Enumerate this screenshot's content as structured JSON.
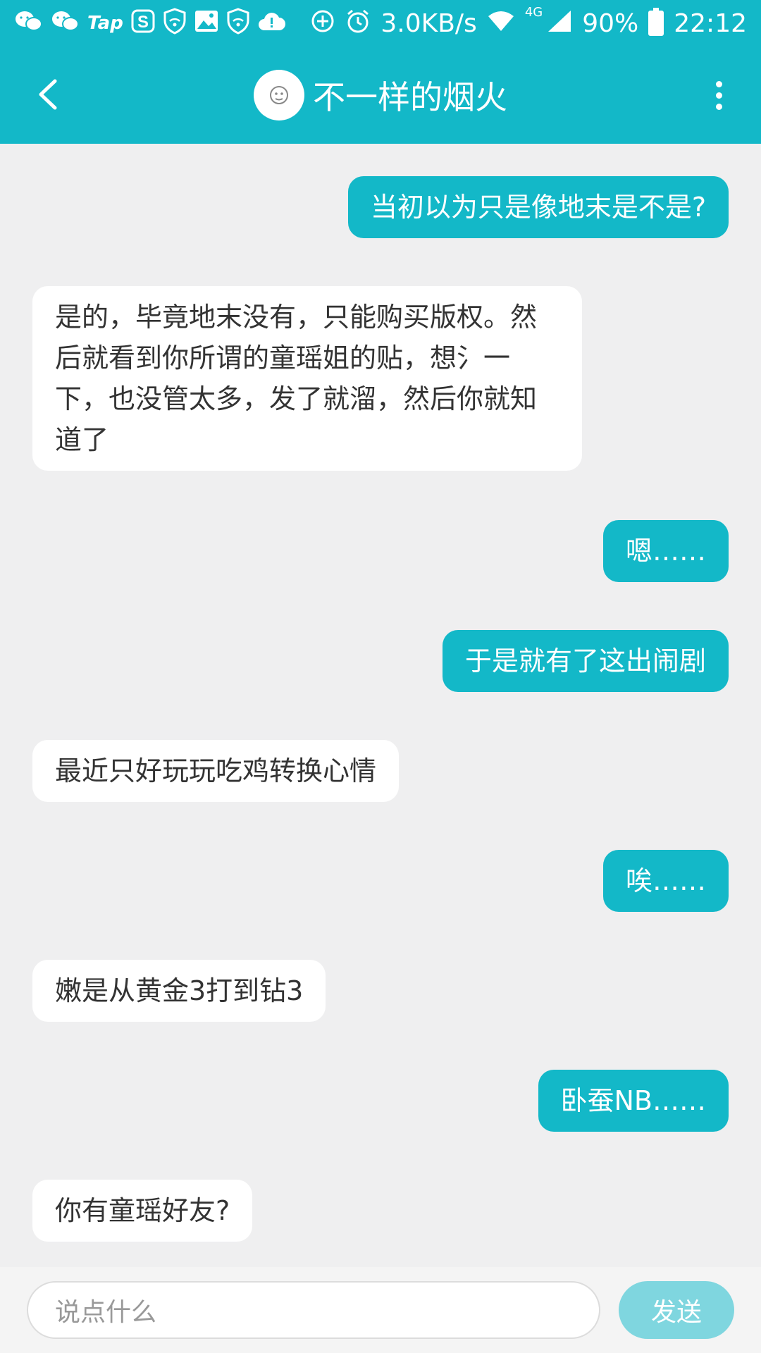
{
  "status_bar": {
    "left_icons": [
      "wechat-icon",
      "wechat-icon",
      "taptap-icon",
      "sogou-icon",
      "vpn-shield-icon",
      "gallery-icon",
      "vpn-shield-icon",
      "cloud-upload-icon"
    ],
    "tap_label": "Tap",
    "net_speed": "3.0KB/s",
    "network_type": "4G",
    "battery": "90%",
    "time": "22:12"
  },
  "header": {
    "title": "不一样的烟火",
    "back_icon": "chevron-left-icon",
    "more_icon": "more-vertical-icon"
  },
  "messages": [
    {
      "direction": "out",
      "text": "当初以为只是像地末是不是?"
    },
    {
      "direction": "in",
      "text": "是的，毕竟地末没有，只能购买版权。然后就看到你所谓的童瑶姐的贴，想氵一下，也没管太多，发了就溜，然后你就知道了"
    },
    {
      "direction": "out",
      "text": "嗯……"
    },
    {
      "direction": "out",
      "text": "于是就有了这出闹剧"
    },
    {
      "direction": "in",
      "text": "最近只好玩玩吃鸡转换心情"
    },
    {
      "direction": "out",
      "text": "唉……"
    },
    {
      "direction": "in",
      "text": "嫩是从黄金3打到钻3"
    },
    {
      "direction": "out",
      "text": "卧蚕NB……"
    },
    {
      "direction": "in",
      "text": "你有童瑶好友?"
    }
  ],
  "composer": {
    "placeholder": "说点什么",
    "send_label": "发送"
  },
  "colors": {
    "accent": "#13b8c8",
    "background": "#efeff0",
    "send_disabled": "#7fd6df"
  }
}
